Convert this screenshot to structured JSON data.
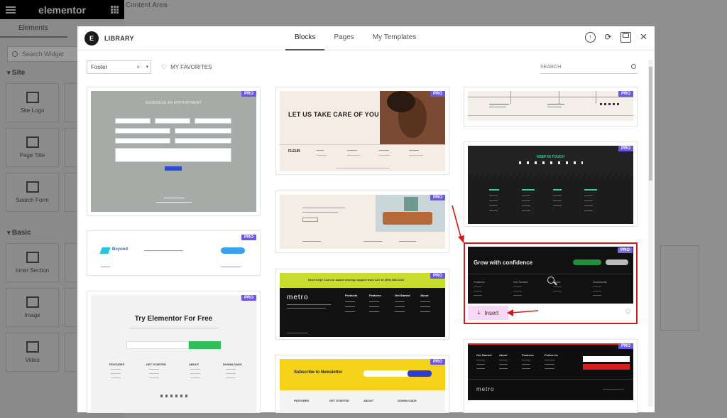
{
  "editor": {
    "logo": "elementor",
    "tab_elements": "Elements",
    "search_placeholder": "Search Widget",
    "category_site": "Site",
    "category_basic": "Basic",
    "site_widgets": [
      "Site Logo",
      "Page Title",
      "Search Form"
    ],
    "basic_widgets": [
      "Inner Section",
      "Image",
      "Video"
    ],
    "content_area": "Content Area"
  },
  "modal": {
    "brand_letter": "E",
    "title": "LIBRARY",
    "tabs": [
      {
        "label": "Blocks",
        "active": true
      },
      {
        "label": "Pages",
        "active": false
      },
      {
        "label": "My Templates",
        "active": false
      }
    ],
    "filter": {
      "value": "Footer",
      "clear": "×",
      "caret": "▾"
    },
    "favorites_label": "MY FAVORITES",
    "search_placeholder": "SEARCH",
    "pro_badge": "PRO",
    "insert_label": "Insert"
  },
  "templates": {
    "appointment_title": "SCHEDULE AN APPOINTMENT",
    "take_care_title": "LET US TAKE CARE OF YOU",
    "beyond_brand": "Beyond",
    "try_title": "Try Elementor For Free",
    "metro_brand": "metro",
    "metro_banner": "Need help? Call our award winning support team 24/7 at (555) 555-1234",
    "metro_cols": [
      "Products",
      "Features",
      "Get Started",
      "About"
    ],
    "keep_in_touch": "KEEP IN TOUCH",
    "grow_title": "Grow with confidence",
    "subscribe_title": "Subscribe to Newsletter",
    "try_cols": [
      "FEATURES",
      "GET STARTED",
      "ABOUT",
      "DOWNLOADS"
    ],
    "dark_cols": [
      "Features",
      "Get Started",
      "About",
      "Downloads"
    ],
    "metro2_cols": [
      "Get Started",
      "About",
      "Features",
      "Follow Us"
    ],
    "metro2_brand": "metro",
    "subscribe_cols": [
      "FEATURES",
      "GET STARTED",
      "ABOUT",
      "DOWNLOADS"
    ]
  },
  "colors": {
    "pro": "#6b58e2",
    "highlight": "#cf1b1b",
    "insert_bg": "#f9d7f4"
  }
}
